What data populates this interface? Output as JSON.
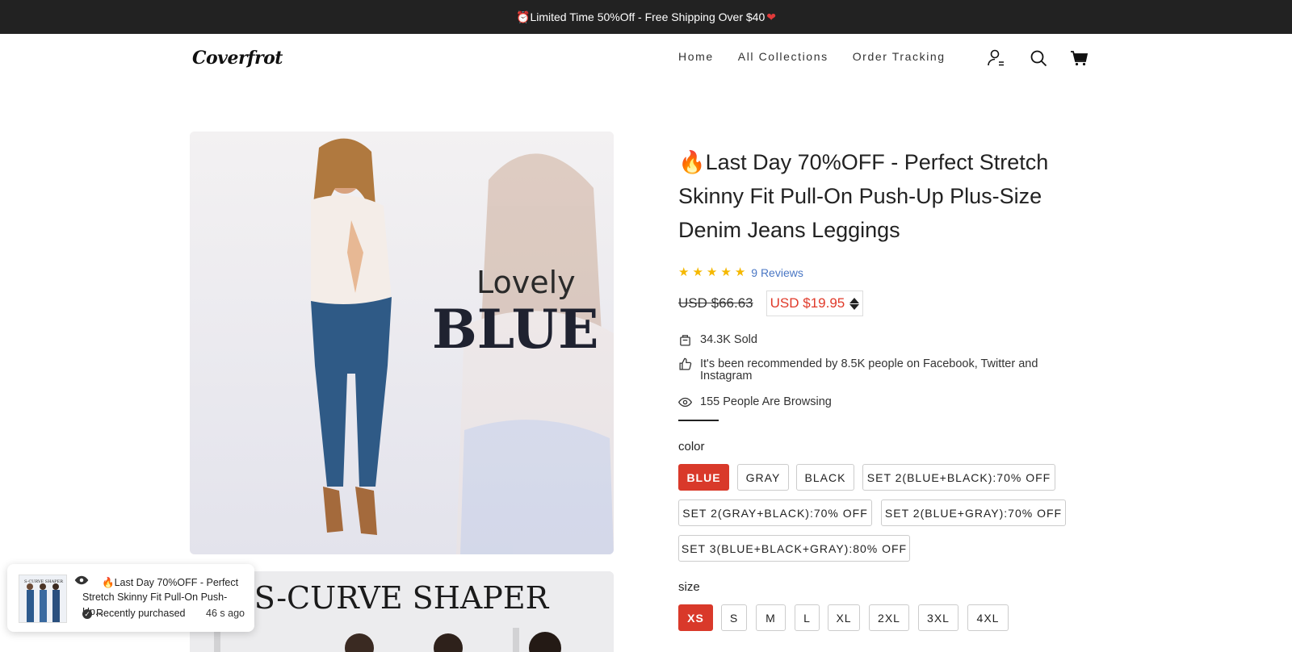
{
  "announcement": {
    "text": "⏰Limited Time 50%Off - Free Shipping Over $40",
    "heart": "❤"
  },
  "header": {
    "logo": "Coverfrot",
    "nav": [
      "Home",
      "All Collections",
      "Order Tracking"
    ],
    "icons": [
      "account-icon",
      "search-icon",
      "cart-icon"
    ]
  },
  "gallery": {
    "image1": {
      "text_line1": "Lovely",
      "text_line2": "BLUE"
    },
    "image2": {
      "text": "S-CURVE  SHAPER"
    }
  },
  "product": {
    "title": "🔥Last Day 70%OFF - Perfect Stretch Skinny Fit Pull-On Push-Up Plus-Size Denim Jeans Leggings",
    "rating": 5,
    "reviews": "9 Reviews",
    "old_price": "USD $66.63",
    "new_price": "USD $19.95",
    "sold": "34.3K Sold",
    "recommended": "It's been recommended by 8.5K people on Facebook, Twitter and Instagram",
    "browsing": "155 People Are Browsing",
    "color_label": "color",
    "colors": [
      "BLUE",
      "GRAY",
      "BLACK",
      "SET 2(BLUE+BLACK):70% OFF",
      "SET 2(GRAY+BLACK):70% OFF",
      "SET 2(BLUE+GRAY):70% OFF",
      "SET 3(BLUE+BLACK+GRAY):80% OFF"
    ],
    "selected_color": "BLUE",
    "size_label": "size",
    "sizes": [
      "XS",
      "S",
      "M",
      "L",
      "XL",
      "2XL",
      "3XL",
      "4XL"
    ],
    "selected_size": "XS"
  },
  "toast": {
    "title": "🔥Last Day 70%OFF - Perfect Stretch Skinny Fit Pull-On Push-Up...",
    "status": "Recently purchased",
    "time": "46 s ago",
    "thumb_text": "S-CURVE SHAPER"
  },
  "colors": {
    "accent": "#d9392a",
    "announce_bg": "#222222",
    "link": "#4a77c4",
    "star": "#f5b800"
  }
}
